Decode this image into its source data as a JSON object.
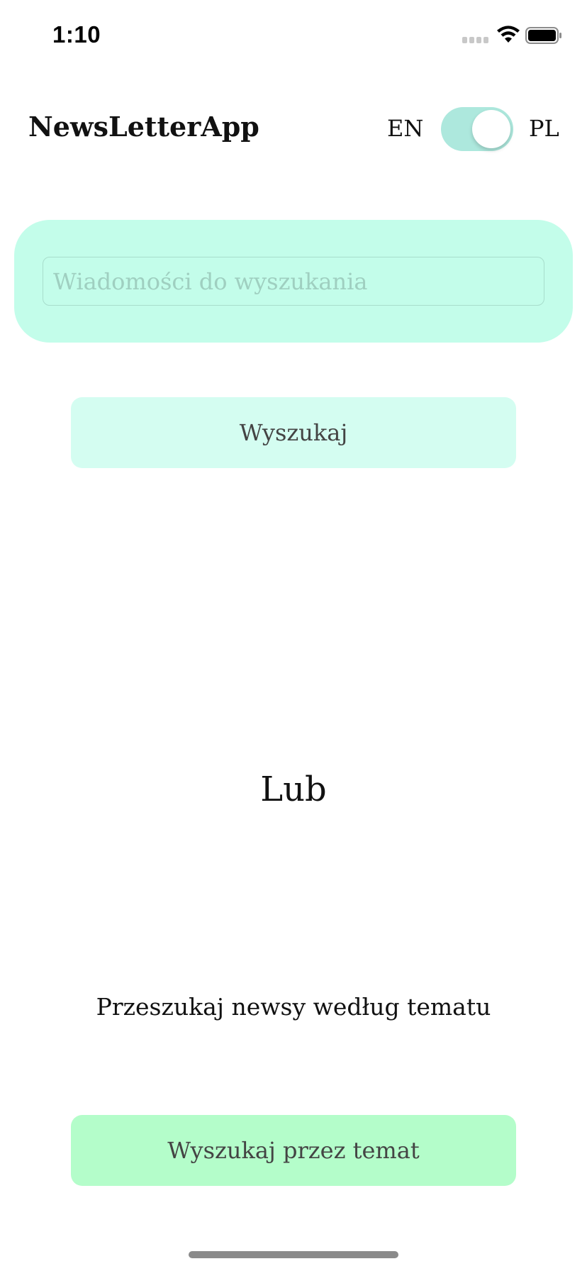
{
  "status_bar": {
    "time": "1:10"
  },
  "header": {
    "app_title": "NewsLetterApp",
    "lang_left": "EN",
    "lang_right": "PL",
    "toggle_on": true
  },
  "search": {
    "placeholder": "Wiadomości do wyszukania",
    "value": "",
    "button_label": "Wyszukaj"
  },
  "divider_label": "Lub",
  "topic": {
    "label": "Przeszukaj newsy według tematu",
    "button_label": "Wyszukaj przez temat"
  },
  "colors": {
    "card_bg": "#c3fdea",
    "search_button_bg": "#d4fdf1",
    "topic_button_bg": "#b4fdca",
    "toggle_track": "#ade8dd"
  }
}
